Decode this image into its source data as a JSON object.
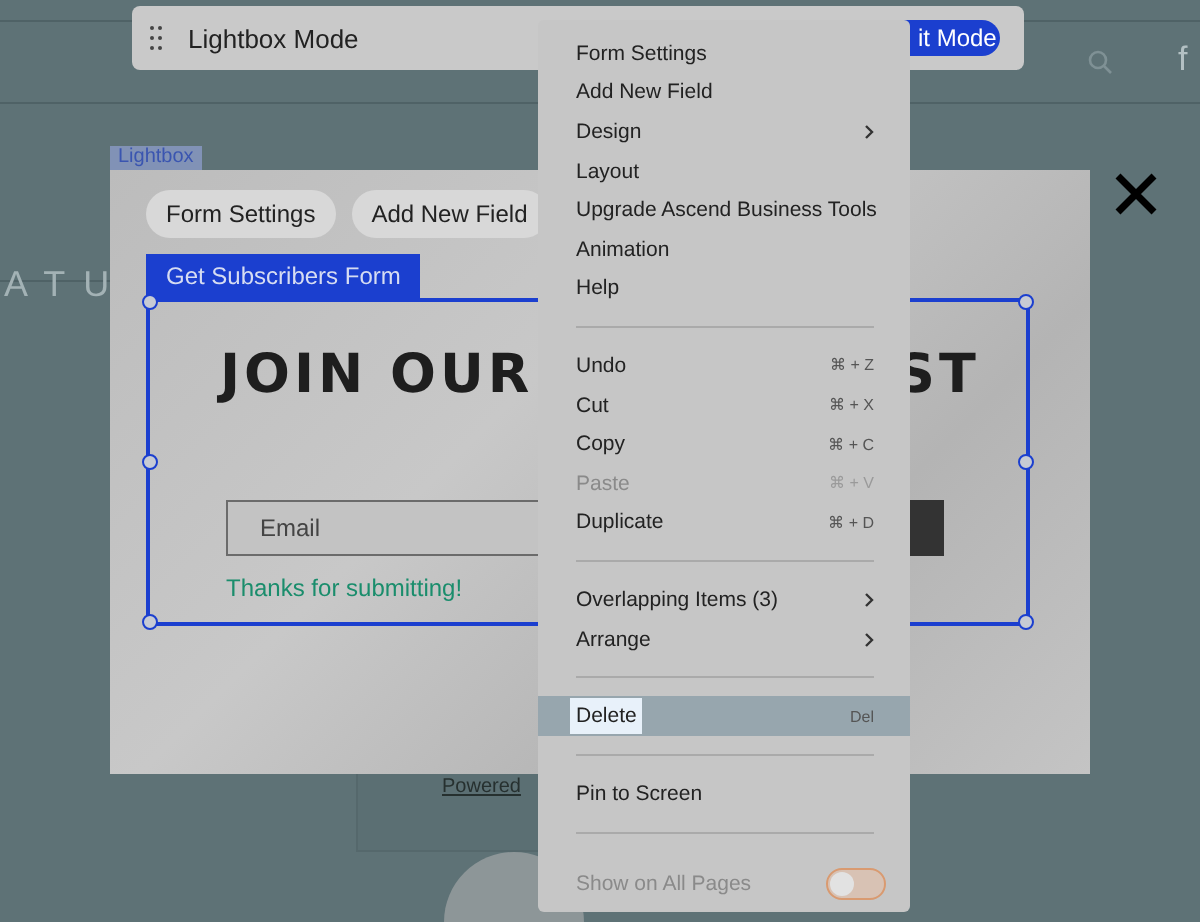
{
  "toolbar": {
    "title": "Lightbox Mode",
    "exit_button": "it Mode"
  },
  "site_background": {
    "side_text": "ATU",
    "social_text": "f",
    "footer_link": "Powered"
  },
  "lightbox": {
    "label": "Lightbox",
    "pills": [
      "Form Settings",
      "Add New Field"
    ],
    "form_tab": "Get Subscribers Form",
    "heading": "JOIN OUR",
    "heading_tail": "ST",
    "email_field": {
      "placeholder": "Email"
    },
    "success_message": "Thanks for submitting!"
  },
  "context_menu": {
    "sections": [
      {
        "items": [
          {
            "kind": "item",
            "label": "Form Settings",
            "submenu": false,
            "disabled": false,
            "selected": false
          },
          {
            "kind": "item",
            "label": "Add New Field",
            "submenu": false,
            "disabled": false,
            "selected": false
          },
          {
            "kind": "item",
            "label": "Design",
            "submenu": true,
            "disabled": false,
            "selected": false
          },
          {
            "kind": "item",
            "label": "Layout",
            "submenu": false,
            "disabled": false,
            "selected": false
          },
          {
            "kind": "item",
            "label": "Upgrade Ascend Business Tools",
            "submenu": false,
            "disabled": false,
            "selected": false
          },
          {
            "kind": "item",
            "label": "Animation",
            "submenu": false,
            "disabled": false,
            "selected": false
          },
          {
            "kind": "item",
            "label": "Help",
            "submenu": false,
            "disabled": false,
            "selected": false
          }
        ]
      },
      {
        "items": [
          {
            "kind": "item",
            "label": "Undo",
            "shortcut": "⌘ + Z",
            "submenu": false,
            "disabled": false,
            "selected": false
          },
          {
            "kind": "item",
            "label": "Cut",
            "shortcut": "⌘ + X",
            "submenu": false,
            "disabled": false,
            "selected": false
          },
          {
            "kind": "item",
            "label": "Copy",
            "shortcut": "⌘ + C",
            "submenu": false,
            "disabled": false,
            "selected": false
          },
          {
            "kind": "item",
            "label": "Paste",
            "shortcut": "⌘ + V",
            "submenu": false,
            "disabled": true,
            "selected": false
          },
          {
            "kind": "item",
            "label": "Duplicate",
            "shortcut": "⌘ + D",
            "submenu": false,
            "disabled": false,
            "selected": false
          }
        ]
      },
      {
        "items": [
          {
            "kind": "item",
            "label": "Overlapping Items (3)",
            "submenu": true,
            "disabled": false,
            "selected": false
          },
          {
            "kind": "item",
            "label": "Arrange",
            "submenu": true,
            "disabled": false,
            "selected": false
          }
        ]
      },
      {
        "items": [
          {
            "kind": "item",
            "label": "Delete",
            "shortcut": "Del",
            "submenu": false,
            "disabled": false,
            "selected": true
          }
        ]
      },
      {
        "items": [
          {
            "kind": "item",
            "label": "Pin to Screen",
            "submenu": false,
            "disabled": false,
            "selected": false
          }
        ]
      },
      {
        "items": [
          {
            "kind": "toggle",
            "label": "Show on All Pages",
            "on": false,
            "disabled": true
          }
        ]
      }
    ]
  }
}
